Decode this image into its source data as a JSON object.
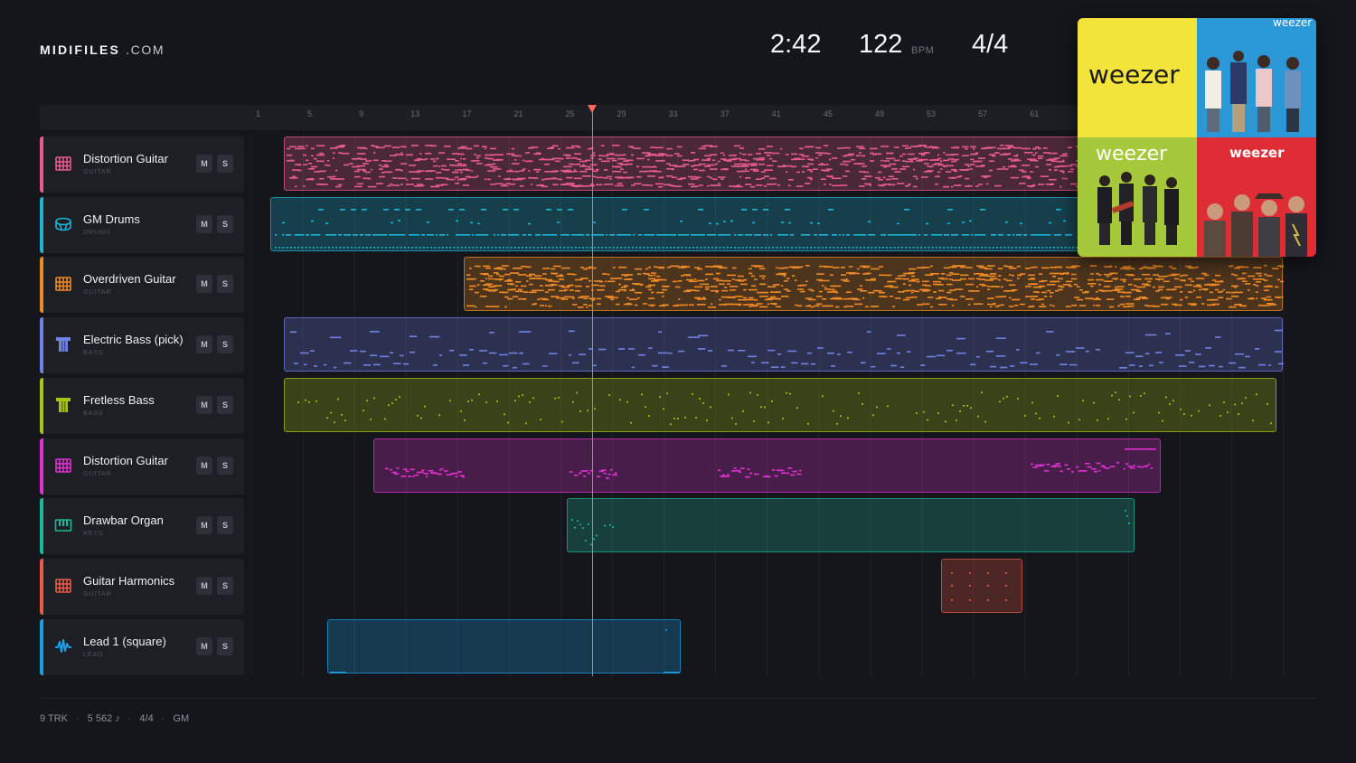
{
  "brand": {
    "bold": "MIDIFILES",
    "light": ".COM"
  },
  "transport": {
    "time": "2:42",
    "bpm": "122",
    "bpm_unit": "BPM",
    "meter": "4/4"
  },
  "ruler": {
    "ticks": [
      "1",
      "5",
      "9",
      "13",
      "17",
      "21",
      "25",
      "29",
      "33",
      "37",
      "41",
      "45",
      "49",
      "53",
      "57",
      "61"
    ]
  },
  "playhead": {
    "bar": 25.4
  },
  "total_bars": 81,
  "tracks": [
    {
      "name": "Distortion Guitar",
      "category": "GUITAR",
      "icon": "guitar-icon",
      "color": "#e75b8d",
      "mute": "M",
      "solo": "S",
      "clips": [
        {
          "start": 3,
          "end": 80
        }
      ],
      "style": "dense"
    },
    {
      "name": "GM Drums",
      "category": "DRUMS",
      "icon": "drum-icon",
      "color": "#20b4d4",
      "mute": "M",
      "solo": "S",
      "clips": [
        {
          "start": 2,
          "end": 80
        }
      ],
      "style": "drums"
    },
    {
      "name": "Overdriven Guitar",
      "category": "GUITAR",
      "icon": "guitar-icon",
      "color": "#f08a24",
      "mute": "M",
      "solo": "S",
      "clips": [
        {
          "start": 17,
          "end": 80.5
        }
      ],
      "style": "dense"
    },
    {
      "name": "Electric Bass (pick)",
      "category": "BASS",
      "icon": "bass-icon",
      "color": "#7181e6",
      "mute": "M",
      "solo": "S",
      "clips": [
        {
          "start": 3,
          "end": 80.5
        }
      ],
      "style": "sparse"
    },
    {
      "name": "Fretless Bass",
      "category": "BASS",
      "icon": "bass-icon",
      "color": "#a6c214",
      "mute": "M",
      "solo": "S",
      "clips": [
        {
          "start": 3,
          "end": 80
        }
      ],
      "style": "scatter"
    },
    {
      "name": "Distortion Guitar",
      "category": "GUITAR",
      "icon": "guitar-icon",
      "color": "#e032d2",
      "mute": "M",
      "solo": "S",
      "clips": [
        {
          "start": 10,
          "end": 71
        }
      ],
      "style": "lead"
    },
    {
      "name": "Drawbar Organ",
      "category": "KEYS",
      "icon": "keys-icon",
      "color": "#1db89a",
      "mute": "M",
      "solo": "S",
      "clips": [
        {
          "start": 25,
          "end": 69
        }
      ],
      "style": "organ"
    },
    {
      "name": "Guitar Harmonics",
      "category": "GUITAR",
      "icon": "guitar-icon",
      "color": "#ea5a44",
      "mute": "M",
      "solo": "S",
      "clips": [
        {
          "start": 54,
          "end": 60.3
        }
      ],
      "style": "harm"
    },
    {
      "name": "Lead 1 (square)",
      "category": "LEAD",
      "icon": "wave-icon",
      "color": "#1c9de6",
      "mute": "M",
      "solo": "S",
      "clips": [
        {
          "start": 6.4,
          "end": 33.8
        }
      ],
      "style": "lead1"
    }
  ],
  "album": {
    "q1": {
      "word": "weezer",
      "bg": "#f2e43a",
      "text": "#1a1a1a"
    },
    "q2": {
      "word": "weezer",
      "bg": "#2a97d6",
      "text": "#ffffff"
    },
    "q3": {
      "word": "weezer",
      "bg": "#a5c93a",
      "text": "#ffffff"
    },
    "q4": {
      "word": "weezer",
      "bg": "#df2d35",
      "text": "#ffffff"
    }
  },
  "footer": {
    "tracks": "9 TRK",
    "notes": "5 562 ♪",
    "meter": "4/4",
    "standard": "GM"
  }
}
